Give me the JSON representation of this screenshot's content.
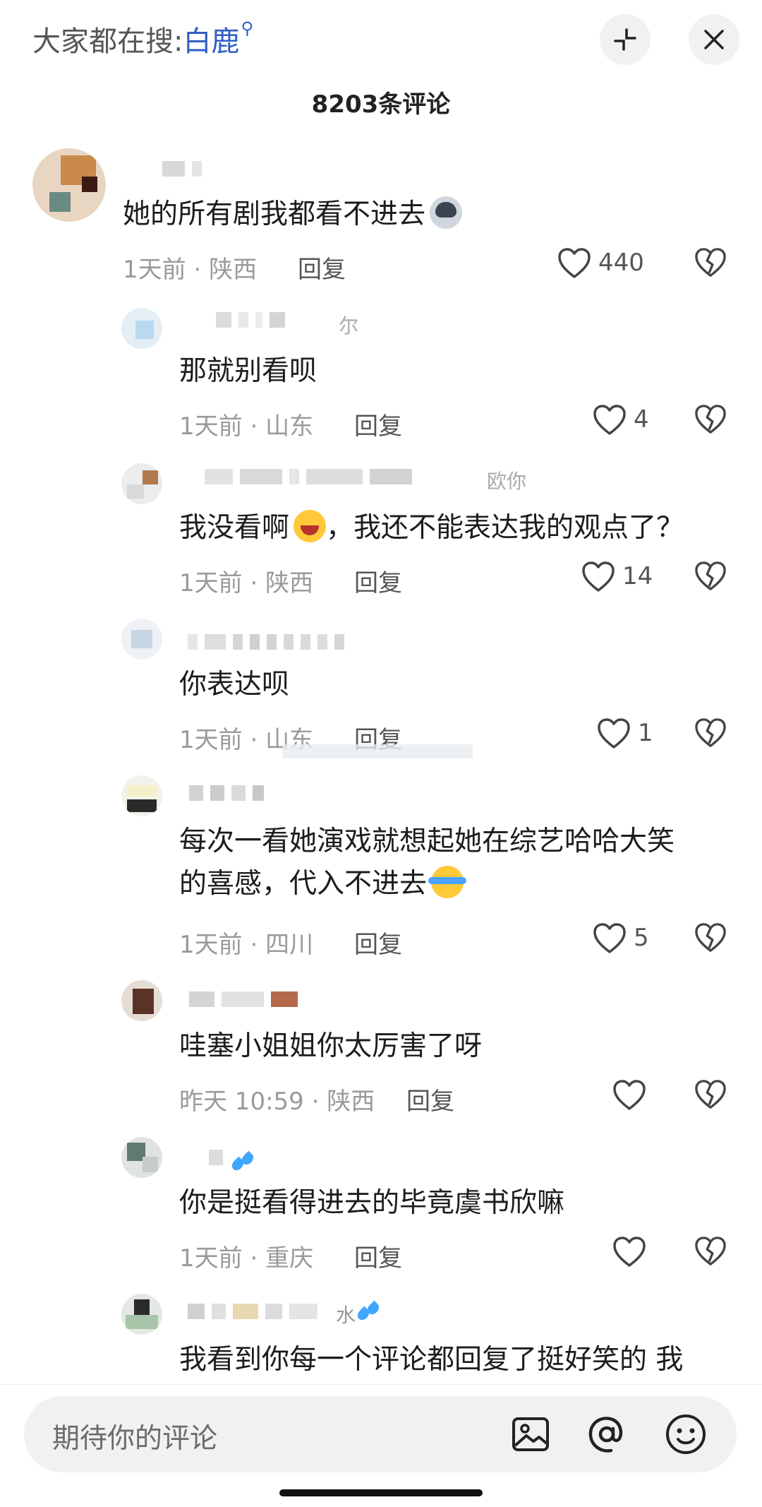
{
  "header": {
    "hot_search_prefix": "大家都在搜:",
    "hot_search_keyword": "白鹿",
    "hot_search_icon": "search-icon",
    "collapse_icon": "collapse-icon",
    "close_icon": "close-icon",
    "comment_count_title": "8203条评论"
  },
  "comments": [
    {
      "username_tail": "",
      "text_lines": [
        "她的所有剧我都看不进去"
      ],
      "emoji": "sly-dog-emoji",
      "time": "1天前",
      "location": "陕西",
      "reply": "回复",
      "likes": "440"
    },
    {
      "username_tail": "尔",
      "text_lines": [
        "那就别看呗"
      ],
      "emoji": "",
      "time": "1天前",
      "location": "山东",
      "reply": "回复",
      "likes": "4"
    },
    {
      "username_tail": "欧你",
      "text_lines": [
        "我没看啊",
        "，我还不能表达我的观点了？"
      ],
      "emoji": "grin-sweat-emoji",
      "time": "1天前",
      "location": "陕西",
      "reply": "回复",
      "likes": "14"
    },
    {
      "username_tail": "",
      "text_lines": [
        "你表达呗"
      ],
      "emoji": "",
      "time": "1天前",
      "location": "山东",
      "reply": "回复",
      "likes": "1"
    },
    {
      "username_tail": "",
      "text_lines": [
        "每次一看她演戏就想起她在综艺哈哈大笑",
        "的喜感，代入不进去"
      ],
      "emoji": "laugh-cry-emoji",
      "time": "1天前",
      "location": "四川",
      "reply": "回复",
      "likes": "5"
    },
    {
      "username_tail": "",
      "text_lines": [
        "哇塞小姐姐你太厉害了呀"
      ],
      "emoji": "",
      "time": "昨天 10:59",
      "location": "陕西",
      "reply": "回复",
      "likes": ""
    },
    {
      "username_tail": "",
      "text_lines": [
        "你是挺看得进去的毕竟虞书欣嘛"
      ],
      "emoji": "",
      "time": "1天前",
      "location": "重庆",
      "reply": "回复",
      "likes": ""
    },
    {
      "username_tail": "水",
      "text_lines": [
        "我看到你每一个评论都回复了挺好笑的 我"
      ],
      "emoji": "",
      "time": "",
      "location": "",
      "reply": "",
      "likes": ""
    }
  ],
  "meta_separator": "·",
  "icons": {
    "like": "heart-outline-icon",
    "dislike": "broken-heart-icon"
  },
  "input": {
    "placeholder": "期待你的评论",
    "image_icon": "image-icon",
    "mention_icon": "at-mention-icon",
    "emoji_icon": "emoji-icon"
  },
  "colors": {
    "accent_blue": "#2f5fc3",
    "meta_gray": "#9a9a9a",
    "input_bg": "#f1f1f1"
  }
}
